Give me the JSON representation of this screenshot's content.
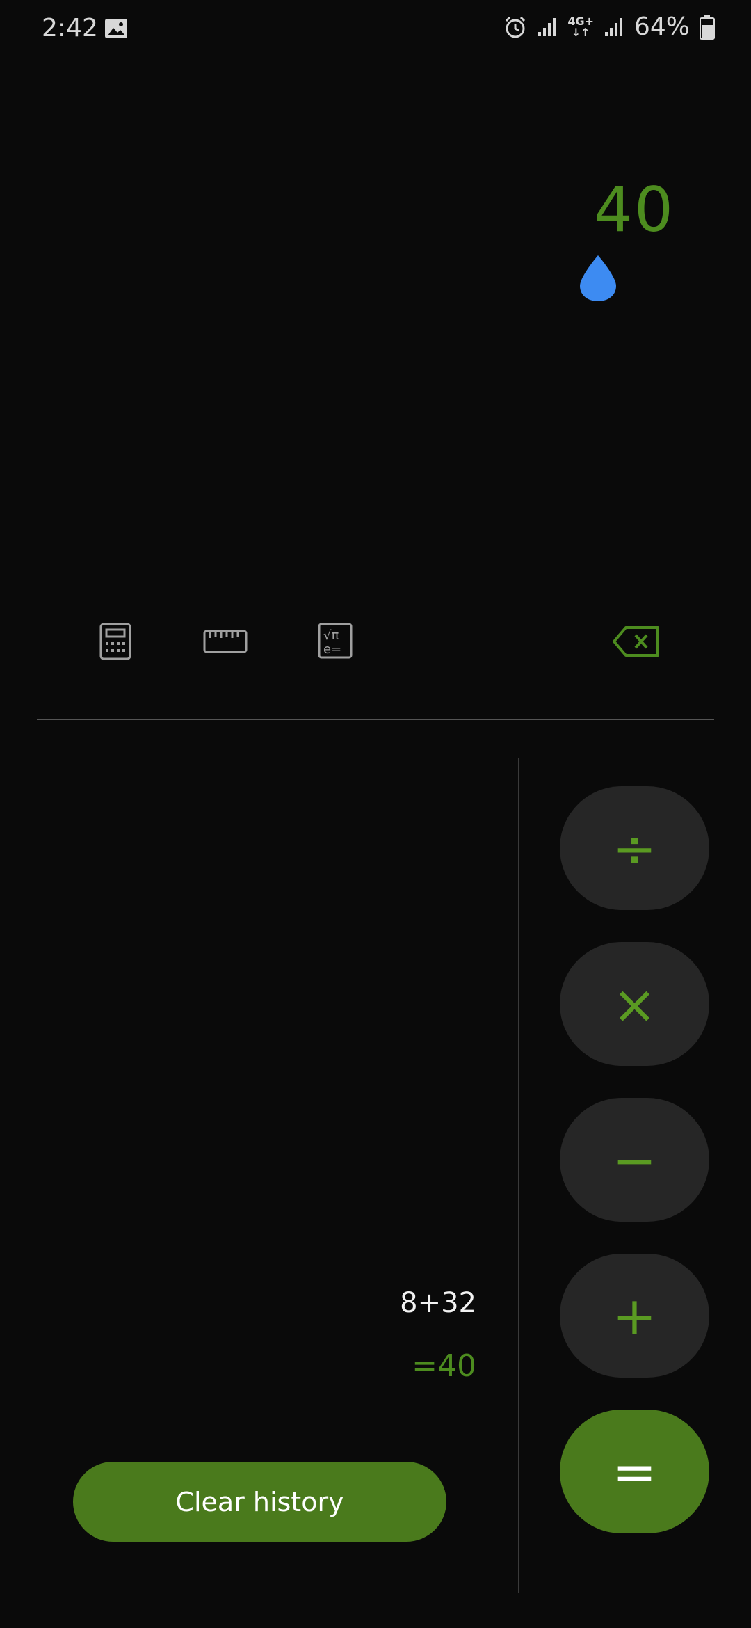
{
  "status_bar": {
    "time": "2:42",
    "battery": "64%",
    "network": "4G+",
    "icons": [
      "gallery-icon",
      "alarm-icon",
      "signal-icon",
      "network-4g-icon",
      "signal-icon",
      "battery-icon"
    ]
  },
  "display": {
    "value": "40"
  },
  "modes": {
    "icons": [
      "calculator-icon",
      "ruler-icon",
      "scientific-icon",
      "backspace-icon"
    ]
  },
  "history": {
    "expression": "8+32",
    "result": "=40",
    "clear_label": "Clear history"
  },
  "operators": {
    "divide": "÷",
    "multiply": "×",
    "subtract": "−",
    "add": "+",
    "equals": "="
  },
  "colors": {
    "accent": "#4d8c1f",
    "accent_button": "#4a7a1c",
    "drop": "#3d8bf2",
    "button_bg": "#262626",
    "background": "#0a0a0a"
  }
}
